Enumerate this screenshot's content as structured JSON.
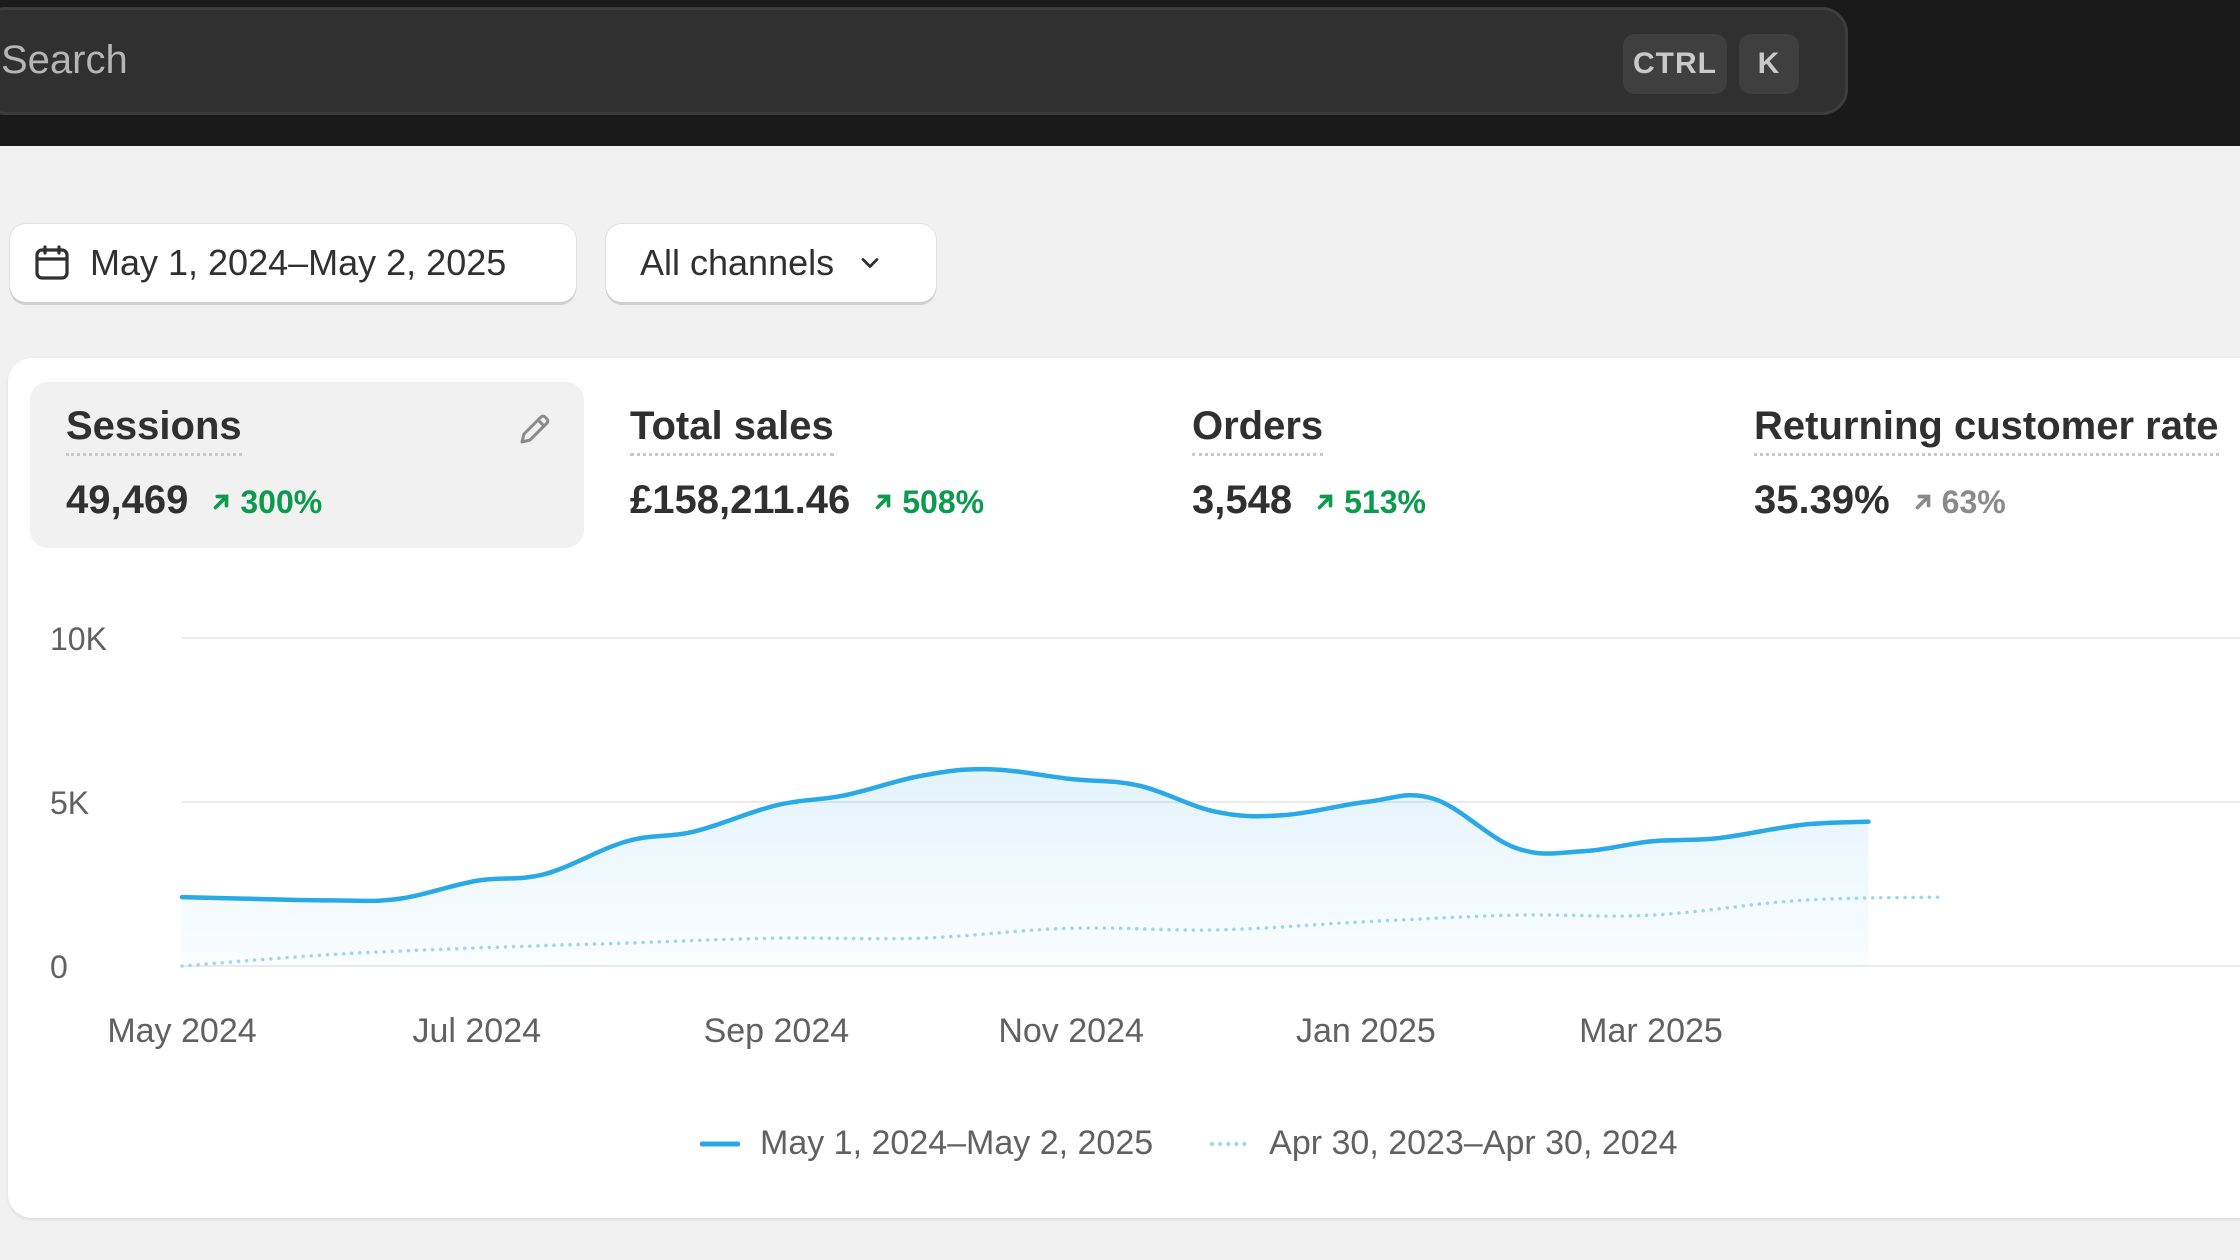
{
  "search": {
    "placeholder": "Search",
    "shortcut_ctrl": "CTRL",
    "shortcut_key": "K"
  },
  "filters": {
    "date_range": "May 1, 2024–May 2, 2025",
    "channel": "All channels"
  },
  "metrics": [
    {
      "title": "Sessions",
      "value": "49,469",
      "change": "300%",
      "trend": "up",
      "selected": true
    },
    {
      "title": "Total sales",
      "value": "£158,211.46",
      "change": "508%",
      "trend": "up",
      "selected": false
    },
    {
      "title": "Orders",
      "value": "3,548",
      "change": "513%",
      "trend": "up",
      "selected": false
    },
    {
      "title": "Returning customer rate",
      "value": "35.39%",
      "change": "63%",
      "trend": "up-neutral",
      "selected": false
    }
  ],
  "colors": {
    "primary_series": "#29a9e5",
    "comparison_series": "#9fd6ef",
    "positive": "#0c9a4f",
    "neutral": "#8a8a8a"
  },
  "chart_data": {
    "type": "line",
    "ylim": [
      0,
      10000
    ],
    "y_ticks": [
      "10K",
      "5K",
      "0"
    ],
    "x_ticks": [
      "May 2024",
      "Jul 2024",
      "Sep 2024",
      "Nov 2024",
      "Jan 2025",
      "Mar 2025"
    ],
    "grid": true,
    "legend_placement": "bottom-center",
    "series": [
      {
        "name": "May 1, 2024–May 2, 2025",
        "style": "solid",
        "x": [
          "2024-05-01",
          "2024-05-15",
          "2024-06-01",
          "2024-06-15",
          "2024-07-01",
          "2024-07-15",
          "2024-08-01",
          "2024-08-15",
          "2024-09-01",
          "2024-09-15",
          "2024-10-01",
          "2024-10-15",
          "2024-11-01",
          "2024-11-15",
          "2024-12-01",
          "2024-12-15",
          "2025-01-01",
          "2025-01-15",
          "2025-02-01",
          "2025-02-15",
          "2025-03-01",
          "2025-03-15",
          "2025-04-01",
          "2025-04-15"
        ],
        "values": [
          2100,
          2050,
          2000,
          2050,
          2600,
          2800,
          3800,
          4100,
          4900,
          5200,
          5800,
          6000,
          5700,
          5500,
          4700,
          4600,
          5000,
          5100,
          3600,
          3500,
          3800,
          3900,
          4300,
          4400
        ]
      },
      {
        "name": "Apr 30, 2023–Apr 30, 2024",
        "style": "dotted",
        "x": [
          "2024-05-01",
          "2024-06-01",
          "2024-07-01",
          "2024-08-01",
          "2024-09-01",
          "2024-10-01",
          "2024-11-01",
          "2024-12-01",
          "2025-01-01",
          "2025-02-01",
          "2025-03-01",
          "2025-04-01",
          "2025-04-30"
        ],
        "values": [
          0,
          350,
          550,
          700,
          850,
          850,
          1150,
          1100,
          1350,
          1550,
          1550,
          2000,
          2100
        ]
      }
    ]
  }
}
